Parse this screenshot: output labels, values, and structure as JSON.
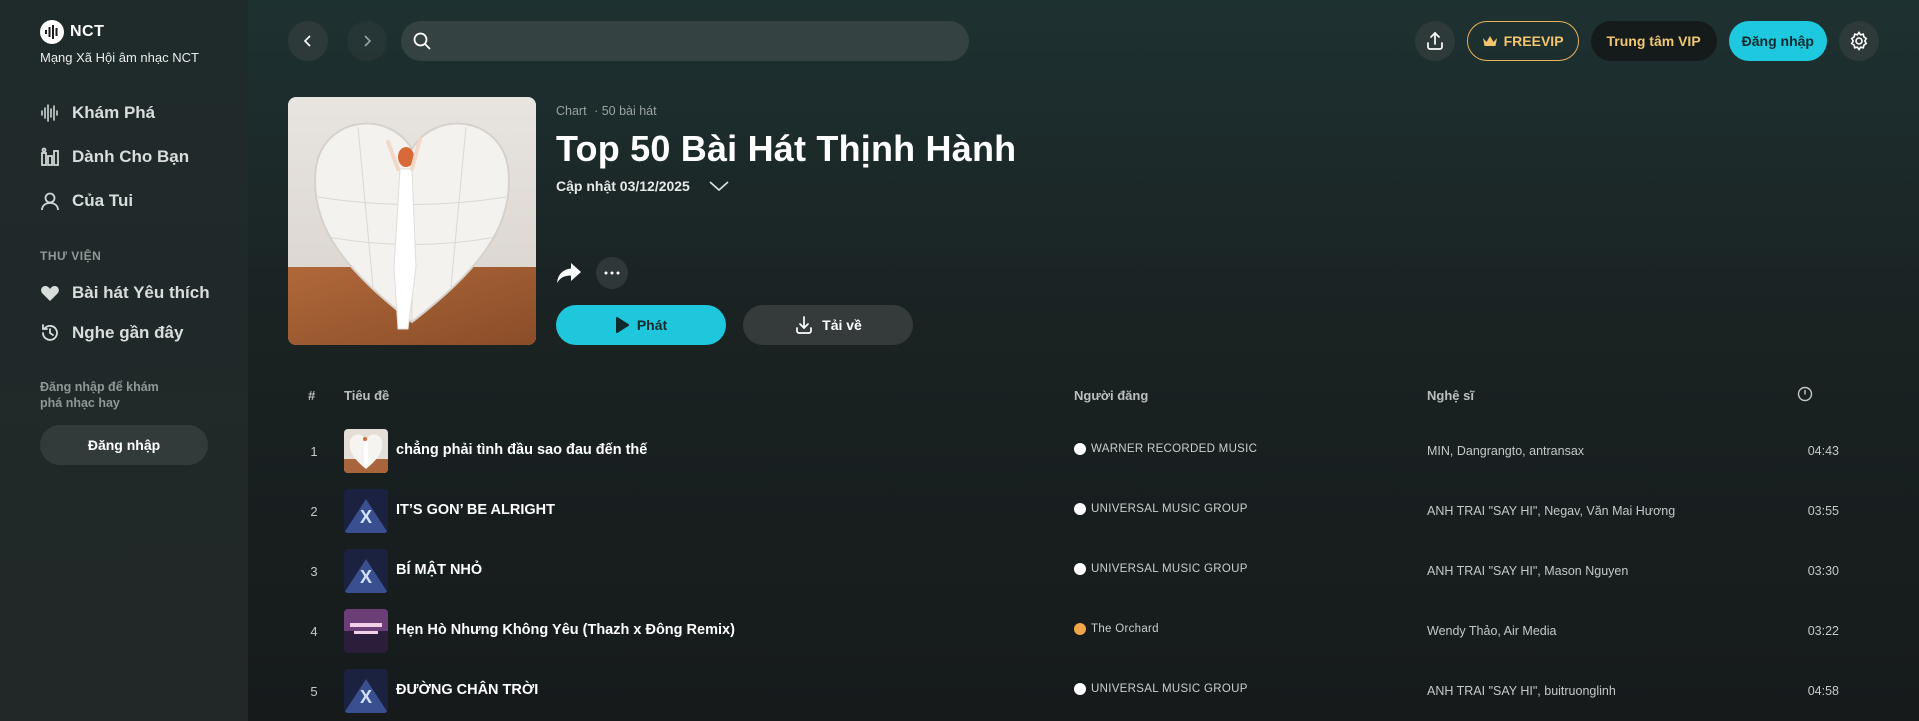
{
  "brand": {
    "logo_text": "NCT",
    "tagline": "Mạng Xã Hội âm nhạc NCT"
  },
  "sidebar": {
    "nav": [
      {
        "label": "Khám Phá",
        "icon": "sound-wave-icon"
      },
      {
        "label": "Dành Cho Bạn",
        "icon": "music-bars-icon"
      },
      {
        "label": "Của Tui",
        "icon": "user-icon"
      }
    ],
    "library_label": "THƯ VIỆN",
    "library": [
      {
        "label": "Bài hát Yêu thích",
        "icon": "heart-icon"
      },
      {
        "label": "Nghe gần đây",
        "icon": "history-icon"
      }
    ],
    "login_hint": "Đăng nhập để khám phá nhạc hay",
    "login_button": "Đăng nhập"
  },
  "topbar": {
    "search_placeholder": "",
    "freevip_label": "FREEVIP",
    "vip_center_label": "Trung tâm VIP",
    "login_label": "Đăng nhập"
  },
  "playlist": {
    "category": "Chart",
    "song_count": "· 50 bài hát",
    "title": "Top 50 Bài Hát Thịnh Hành",
    "updated": "Cập nhật 03/12/2025",
    "play_label": "Phát",
    "download_label": "Tải về"
  },
  "table": {
    "headers": {
      "index": "#",
      "title": "Tiêu đề",
      "uploader": "Người đăng",
      "artist": "Nghệ sĩ"
    },
    "rows": [
      {
        "n": "1",
        "title": "chẳng phải tình đầu sao đau đến thế",
        "uploader": "WARNER RECORDED MUSIC",
        "artist": "MIN, Dangrangto, antransax",
        "duration": "04:43"
      },
      {
        "n": "2",
        "title": "IT’S GON’ BE ALRIGHT",
        "uploader": "UNIVERSAL MUSIC GROUP",
        "artist": "ANH TRAI \"SAY HI\", Negav, Văn Mai Hương",
        "duration": "03:55"
      },
      {
        "n": "3",
        "title": "BÍ MẬT NHỎ",
        "uploader": "UNIVERSAL MUSIC GROUP",
        "artist": "ANH TRAI \"SAY HI\", Mason Nguyen",
        "duration": "03:30"
      },
      {
        "n": "4",
        "title": "Hẹn Hò Nhưng Không Yêu (Thazh x Đông Remix)",
        "uploader": "The Orchard",
        "artist": "Wendy Thảo, Air Media",
        "duration": "03:22"
      },
      {
        "n": "5",
        "title": "ĐƯỜNG CHÂN TRỜI",
        "uploader": "UNIVERSAL MUSIC GROUP",
        "artist": "ANH TRAI \"SAY HI\", buitruonglinh",
        "duration": "04:58"
      }
    ]
  },
  "colors": {
    "accent": "#1ec9e0",
    "vip_gold": "#f0c873",
    "background": "#181d1f"
  }
}
